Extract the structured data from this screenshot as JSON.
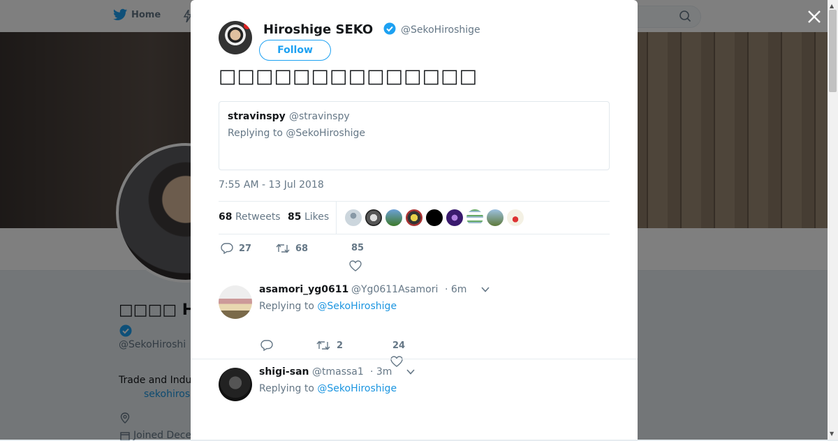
{
  "nav": {
    "home_label": "Home",
    "search_placeholder": ""
  },
  "background_profile": {
    "name": "□□□□ Hiro",
    "handle": "@SekoHiroshi",
    "bio": "Trade and Indu",
    "link": "sekohiros",
    "joined": "Joined Dece"
  },
  "tweet": {
    "author_name": "Hiroshige SEKO",
    "author_handle": "@SekoHiroshige",
    "follow_label": "Follow",
    "text": "□□□□□□□□□□□□□□",
    "quote": {
      "name": "stravinspy",
      "handle": "@stravinspy",
      "replying": "Replying to @SekoHiroshige"
    },
    "timestamp": "7:55 AM - 13 Jul 2018",
    "retweets_count": "68",
    "retweets_label": "Retweets",
    "likes_count": "85",
    "likes_label": "Likes",
    "actions": {
      "replies": "27",
      "retweets": "68",
      "likes": "85"
    }
  },
  "replies": [
    {
      "name": "asamori_yg0611",
      "handle": "@Yg0611Asamori",
      "time": "· 6m",
      "replying_prefix": "Replying to",
      "replying_to": "@SekoHiroshige",
      "replies": "",
      "retweets": "2",
      "likes": "24"
    },
    {
      "name": "shigi-san",
      "handle": "@tmassa1",
      "time": "· 3m",
      "replying_prefix": "Replying to",
      "replying_to": "@SekoHiroshige"
    }
  ],
  "colors": {
    "accent": "#1da1f2",
    "link": "#1b95e0",
    "muted": "#657786"
  },
  "icons": [
    "twitter-bird-icon",
    "search-icon",
    "verified-badge-icon",
    "close-icon",
    "reply-icon",
    "retweet-icon",
    "heart-icon",
    "caret-down-icon",
    "location-icon",
    "calendar-icon"
  ]
}
